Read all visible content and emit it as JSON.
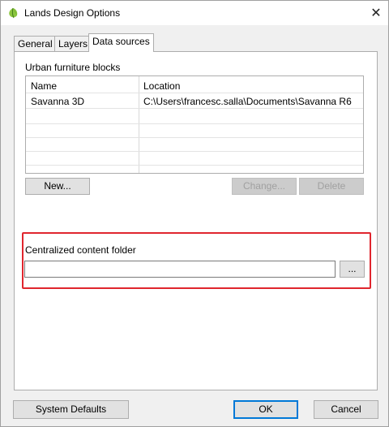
{
  "window": {
    "title": "Lands Design Options",
    "close_glyph": "✕"
  },
  "tabs": [
    {
      "label": "General",
      "active": false
    },
    {
      "label": "Layers",
      "active": false
    },
    {
      "label": "Data sources",
      "active": true
    }
  ],
  "urban_furniture": {
    "section_label": "Urban furniture blocks",
    "columns": [
      "Name",
      "Location"
    ],
    "rows": [
      {
        "name": "Savanna 3D",
        "location": "C:\\Users\\francesc.salla\\Documents\\Savanna R6"
      },
      {
        "name": "",
        "location": ""
      },
      {
        "name": "",
        "location": ""
      },
      {
        "name": "",
        "location": ""
      },
      {
        "name": "",
        "location": ""
      }
    ],
    "buttons": {
      "new": "New...",
      "change": "Change...",
      "delete": "Delete"
    }
  },
  "centralized": {
    "label": "Centralized content folder",
    "value": "",
    "browse": "..."
  },
  "footer": {
    "system_defaults": "System Defaults",
    "ok": "OK",
    "cancel": "Cancel"
  },
  "colors": {
    "highlight": "#e0262e",
    "default_button_border": "#0078d7",
    "app_icon": "#8cc63f"
  },
  "icons": {
    "app": "lands-design-leaf-icon",
    "close": "close-icon"
  }
}
